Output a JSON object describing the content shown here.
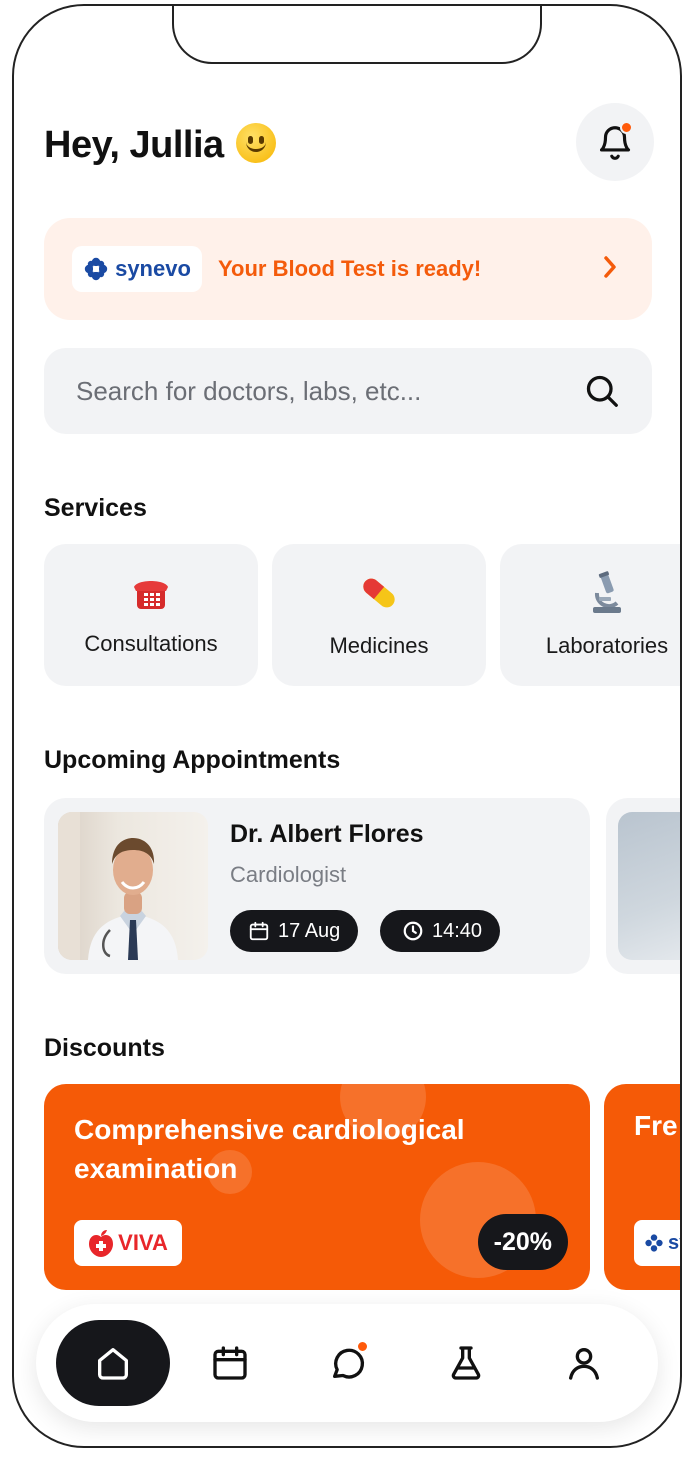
{
  "header": {
    "greeting": "Hey, Jullia",
    "emoji": "slightly-smiling-face"
  },
  "notifications": {
    "icon": "bell-icon",
    "has_unread": true
  },
  "banner": {
    "partner_logo_text": "synevo",
    "message": "Your Blood Test is ready!",
    "accent_color": "#f45b0b",
    "background_color": "#fff1ea"
  },
  "search": {
    "placeholder": "Search for doctors, labs, etc..."
  },
  "services": {
    "title": "Services",
    "items": [
      {
        "label": "Consultations",
        "icon": "telephone-icon"
      },
      {
        "label": "Medicines",
        "icon": "pill-icon"
      },
      {
        "label": "Laboratories",
        "icon": "microscope-icon"
      }
    ]
  },
  "appointments": {
    "title": "Upcoming Appointments",
    "items": [
      {
        "doctor": "Dr. Albert Flores",
        "specialty": "Cardiologist",
        "date": "17 Aug",
        "time": "14:40"
      }
    ]
  },
  "discounts": {
    "title": "Discounts",
    "items": [
      {
        "title": "Comprehensive cardiological examination",
        "partner_logo_text": "VIVA",
        "discount": "-20%"
      },
      {
        "title": "Fre",
        "partner_logo_text": "sy"
      }
    ],
    "card_color": "#f55a07"
  },
  "tabbar": {
    "items": [
      {
        "name": "home",
        "icon": "home-icon",
        "active": true
      },
      {
        "name": "calendar",
        "icon": "calendar-icon",
        "active": false
      },
      {
        "name": "chat",
        "icon": "chat-icon",
        "active": false,
        "has_badge": true
      },
      {
        "name": "lab",
        "icon": "flask-icon",
        "active": false
      },
      {
        "name": "profile",
        "icon": "user-icon",
        "active": false
      }
    ]
  }
}
